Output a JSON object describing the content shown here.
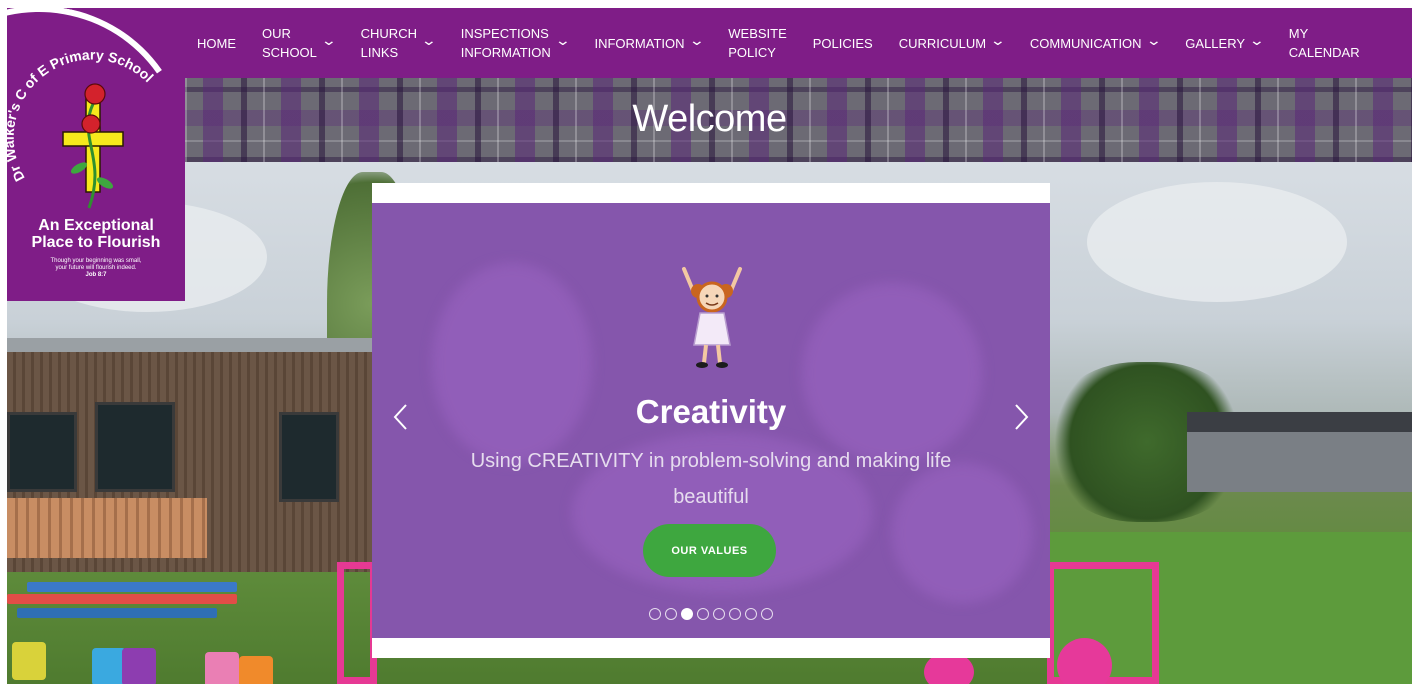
{
  "school": {
    "name": "Dr Walker's C of E Primary School",
    "tagline_line1": "An Exceptional",
    "tagline_line2": "Place to Flourish",
    "verse_line1": "Though your beginning was small,",
    "verse_line2": "your future will flourish indeed.",
    "verse_ref": "Job 8:7"
  },
  "nav": {
    "items": [
      {
        "label": "HOME",
        "has_dropdown": false
      },
      {
        "label": "OUR SCHOOL",
        "line1": "OUR",
        "line2": "SCHOOL",
        "has_dropdown": true
      },
      {
        "label": "CHURCH LINKS",
        "line1": "CHURCH",
        "line2": "LINKS",
        "has_dropdown": true
      },
      {
        "label": "INSPECTIONS INFORMATION",
        "line1": "INSPECTIONS",
        "line2": "INFORMATION",
        "has_dropdown": true
      },
      {
        "label": "INFORMATION",
        "has_dropdown": true
      },
      {
        "label": "WEBSITE POLICY",
        "line1": "WEBSITE",
        "line2": "POLICY",
        "has_dropdown": false
      },
      {
        "label": "POLICIES",
        "has_dropdown": false
      },
      {
        "label": "CURRICULUM",
        "has_dropdown": true
      },
      {
        "label": "COMMUNICATION",
        "has_dropdown": true
      },
      {
        "label": "GALLERY",
        "has_dropdown": true
      },
      {
        "label": "MY CALENDAR",
        "line1": "MY",
        "line2": "CALENDAR",
        "has_dropdown": false
      }
    ]
  },
  "banner": {
    "title": "Welcome"
  },
  "slider": {
    "title": "Creativity",
    "text": "Using CREATIVITY in problem-solving and making life beautiful",
    "button_label": "OUR VALUES",
    "prev_icon": "chevron-left-icon",
    "next_icon": "chevron-right-icon",
    "total_slides": 8,
    "active_slide": 3
  },
  "colors": {
    "brand_purple": "#7f1d87",
    "slide_purple": "#8556ac",
    "button_green": "#3ea73f"
  }
}
